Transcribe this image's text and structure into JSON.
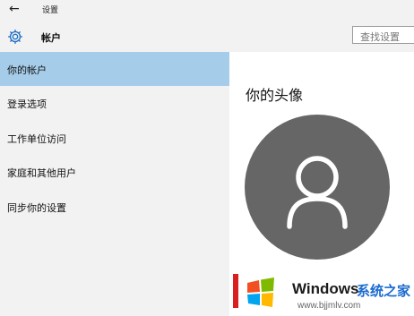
{
  "titlebar": {
    "title": "设置",
    "back_icon": "back-arrow-icon"
  },
  "header": {
    "section_icon": "gear-icon",
    "section_title": "帐户",
    "search_placeholder": "查找设置"
  },
  "sidebar": {
    "items": [
      {
        "label": "你的帐户",
        "active": true
      },
      {
        "label": "登录选项",
        "active": false
      },
      {
        "label": "工作单位访问",
        "active": false
      },
      {
        "label": "家庭和其他用户",
        "active": false
      },
      {
        "label": "同步你的设置",
        "active": false
      }
    ]
  },
  "main": {
    "title": "你的头像",
    "avatar_icon": "user-silhouette-icon"
  },
  "watermark": {
    "logo_icon": "windows-logo-icon",
    "brand": "Windows",
    "site": "系统之家",
    "url": "www.bjjmlv.com"
  },
  "colors": {
    "selected": "#a5cde9",
    "sidebar_bg": "#f2f2f2",
    "content_bg": "#ffffff",
    "avatar_bg": "#666666",
    "site_text": "#1a6bd0"
  }
}
